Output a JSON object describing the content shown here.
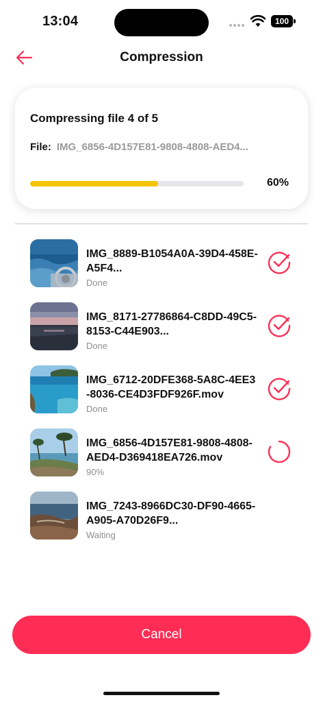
{
  "status_bar": {
    "time": "13:04",
    "battery": "100"
  },
  "header": {
    "title": "Compression",
    "back_icon": "arrow-left-icon"
  },
  "progress": {
    "heading": "Compressing file 4 of 5",
    "file_label": "File:",
    "file_name": "IMG_6856-4D157E81-9808-4808-AED4...",
    "percent_text": "60%",
    "percent_value": 0.6,
    "fill_color": "#f5c400"
  },
  "files": [
    {
      "name": "IMG_8889-B1054A0A-39D4-458E-A5F4...",
      "status": "Done",
      "icon": "check-circle-icon"
    },
    {
      "name": "IMG_8171-27786864-C8DD-49C5-8153-C44E903...",
      "status": "Done",
      "icon": "check-circle-icon"
    },
    {
      "name": "IMG_6712-20DFE368-5A8C-4EE3-8036-CE4D3FDF926F.mov",
      "status": "Done",
      "icon": "check-circle-icon"
    },
    {
      "name": "IMG_6856-4D157E81-9808-4808-AED4-D369418EA726.mov",
      "status": "90%",
      "icon": "spinner-icon"
    },
    {
      "name": "IMG_7243-8966DC30-DF90-4665-A905-A70D26F9...",
      "status": "Waiting",
      "icon": "none"
    }
  ],
  "cancel_label": "Cancel",
  "colors": {
    "accent": "#ff2d55",
    "progress": "#f5c400",
    "muted": "#8e8e93"
  }
}
